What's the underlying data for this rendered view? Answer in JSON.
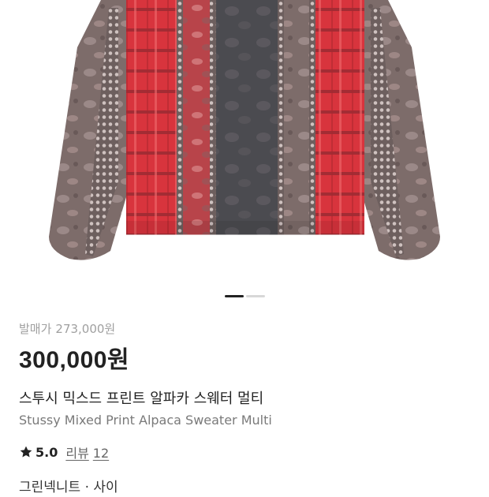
{
  "product": {
    "release_price_label": "발매가",
    "release_price": "273,000원",
    "price": "300,000원",
    "name_ko": "스투시 믹스드 프린트 알파카 스웨터 멀티",
    "name_en": "Stussy Mixed Print Alpaca Sweater Multi",
    "rating": "5.0",
    "reviews_label": "리뷰",
    "reviews_count": "12",
    "seller": "그린넥니트 · 사이"
  },
  "carousel": {
    "total": 2,
    "active": 1
  },
  "icons": {
    "rating": "star-icon"
  },
  "colors": {
    "price": "#222222",
    "muted": "#a0a0a0",
    "dot_active": "#222222",
    "dot_inactive": "#d8d8d8",
    "sweater_red": "#d8343d",
    "sweater_charcoal": "#4e4e52",
    "sweater_taupe": "#7b6a68"
  }
}
